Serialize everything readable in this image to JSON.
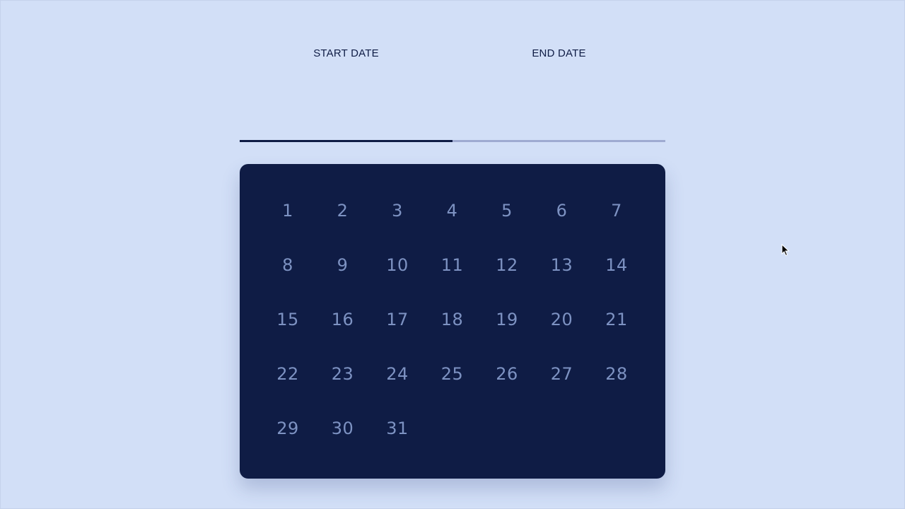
{
  "tabs": {
    "start_label": "START DATE",
    "end_label": "END DATE"
  },
  "calendar": {
    "days": [
      "1",
      "2",
      "3",
      "4",
      "5",
      "6",
      "7",
      "8",
      "9",
      "10",
      "11",
      "12",
      "13",
      "14",
      "15",
      "16",
      "17",
      "18",
      "19",
      "20",
      "21",
      "22",
      "23",
      "24",
      "25",
      "26",
      "27",
      "28",
      "29",
      "30",
      "31"
    ]
  },
  "colors": {
    "background": "#d2dff7",
    "calendar_bg": "#0f1c45",
    "day_text": "#7d92c2",
    "active_tab_bar": "#0f1c45",
    "inactive_tab_bar": "#9fabd1"
  },
  "icons": {
    "cursor": "mouse-pointer-icon"
  }
}
